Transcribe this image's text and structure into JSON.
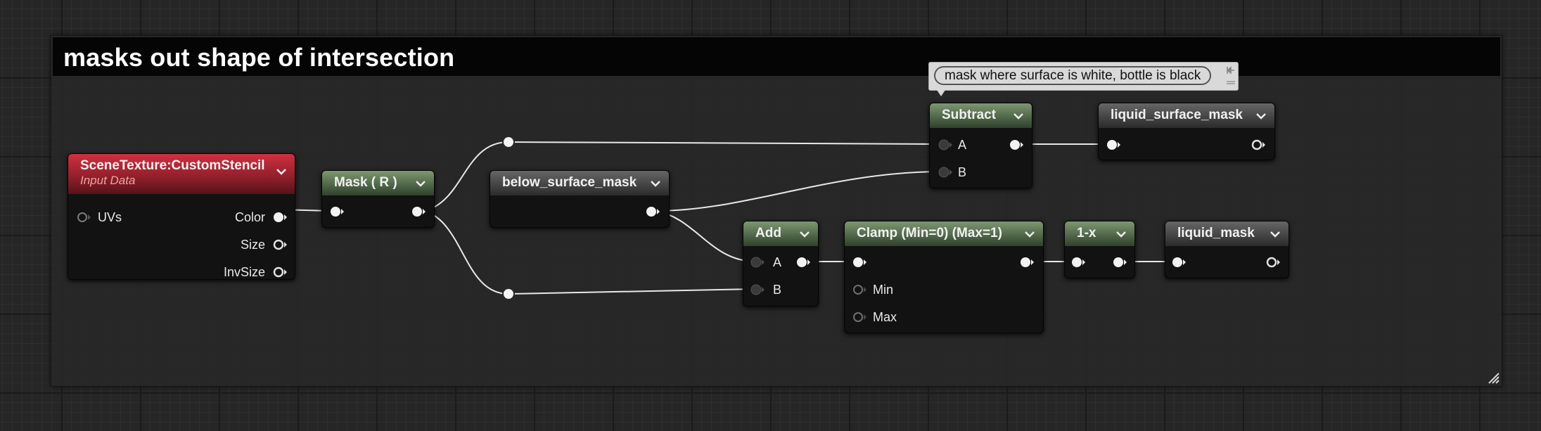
{
  "comment": {
    "title": "masks out shape of intersection"
  },
  "tooltip": {
    "text": "mask where surface is white, bottle is black"
  },
  "nodes": {
    "scene_texture": {
      "title": "SceneTexture:CustomStencil",
      "subtitle": "Input Data",
      "inputs": [
        "UVs"
      ],
      "outputs": [
        "Color",
        "Size",
        "InvSize"
      ]
    },
    "mask": {
      "title": "Mask ( R )"
    },
    "below_surface": {
      "title": "below_surface_mask"
    },
    "subtract": {
      "title": "Subtract",
      "inputs": [
        "A",
        "B"
      ]
    },
    "liquid_surface": {
      "title": "liquid_surface_mask"
    },
    "add": {
      "title": "Add",
      "inputs": [
        "A",
        "B"
      ]
    },
    "clamp": {
      "title": "Clamp (Min=0) (Max=1)",
      "inputs": [
        "Min",
        "Max"
      ]
    },
    "one_minus": {
      "title": "1-x"
    },
    "liquid_mask": {
      "title": "liquid_mask"
    }
  },
  "colors": {
    "material_header": "#5d7452",
    "parameter_header": "#4a4a4a",
    "input_data_header": "#a2202d",
    "wire": "#e8e8e8",
    "grid_background": "#262626"
  }
}
